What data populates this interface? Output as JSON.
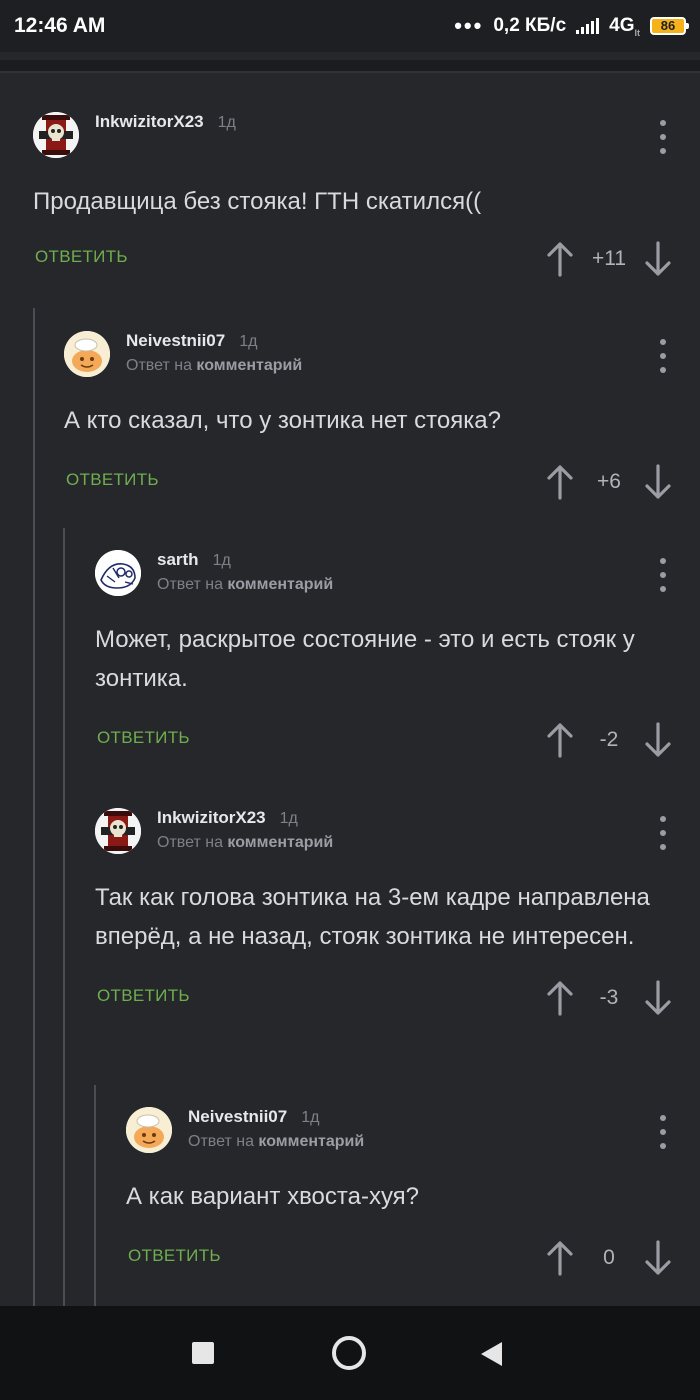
{
  "status_bar": {
    "time": "12:46 AM",
    "more": "•••",
    "net_speed": "0,2 КБ/с",
    "network": "4G",
    "network_sub": "lt",
    "battery": "86"
  },
  "comments": [
    {
      "username": "InkwizitorX23",
      "time": "1д",
      "avatar": "skull-shield",
      "reply_prefix": "",
      "reply_target": "",
      "text": "Продавщица без стояка! ГТН скатился((",
      "reply_label": "ОТВЕТИТЬ",
      "score": "+11"
    },
    {
      "username": "Neivestnii07",
      "time": "1д",
      "avatar": "cartoon-face",
      "reply_prefix": "Ответ на",
      "reply_target": "комментарий",
      "text": "А кто сказал, что у зонтика нет стояка?",
      "reply_label": "ОТВЕТИТЬ",
      "score": "+6"
    },
    {
      "username": "sarth",
      "time": "1д",
      "avatar": "sketch-drawing",
      "reply_prefix": "Ответ на",
      "reply_target": "комментарий",
      "text": "Может, раскрытое состояние - это и есть стояк у зонтика.",
      "reply_label": "ОТВЕТИТЬ",
      "score": "-2"
    },
    {
      "username": "InkwizitorX23",
      "time": "1д",
      "avatar": "skull-shield",
      "reply_prefix": "Ответ на",
      "reply_target": "комментарий",
      "text": "Так как голова зонтика на 3-ем кадре направлена вперёд, а не назад, стояк зонтика не интересен.",
      "reply_label": "ОТВЕТИТЬ",
      "score": "-3"
    },
    {
      "username": "Neivestnii07",
      "time": "1д",
      "avatar": "cartoon-face",
      "reply_prefix": "Ответ на",
      "reply_target": "комментарий",
      "text": "А как вариант хвоста-хуя?",
      "reply_label": "ОТВЕТИТЬ",
      "score": "0"
    }
  ],
  "icons": {
    "upvote": "arrow-up-icon",
    "downvote": "arrow-down-icon",
    "more": "more-vertical-icon",
    "nav_recent": "square-icon",
    "nav_home": "circle-icon",
    "nav_back": "triangle-back-icon"
  },
  "colors": {
    "background": "#25272b",
    "reply_link": "#6fae4f",
    "status_bar": "#1d1f22",
    "nav_bar": "#111214"
  }
}
